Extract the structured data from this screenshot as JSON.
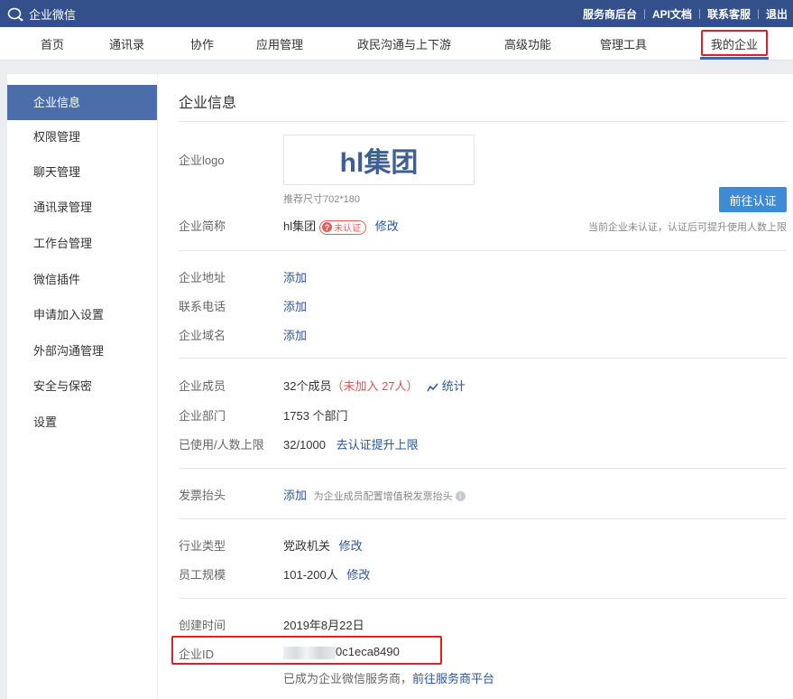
{
  "topbar": {
    "brand": "企业微信",
    "links": [
      "服务商后台",
      "API文档",
      "联系客服",
      "退出"
    ]
  },
  "nav": {
    "items": [
      "首页",
      "通讯录",
      "协作",
      "应用管理",
      "政民沟通与上下游",
      "高级功能",
      "管理工具",
      "我的企业"
    ],
    "active": "我的企业"
  },
  "sidebar": {
    "items": [
      "企业信息",
      "权限管理",
      "聊天管理",
      "通讯录管理",
      "工作台管理",
      "微信插件",
      "申请加入设置",
      "外部沟通管理",
      "安全与保密",
      "设置"
    ],
    "active": "企业信息"
  },
  "main": {
    "title": "企业信息",
    "logo": {
      "label": "企业logo",
      "text": "hl集团",
      "hint": "推荐尺寸702*180"
    },
    "cert": {
      "button": "前往认证",
      "hint": "当前企业未认证，认证后可提升使用人数上限"
    },
    "short_name": {
      "label": "企业简称",
      "value": "hl集团",
      "badge": "未认证",
      "badge_icon": "?",
      "action": "修改"
    },
    "address": {
      "label": "企业地址",
      "action": "添加"
    },
    "phone": {
      "label": "联系电话",
      "action": "添加"
    },
    "domain": {
      "label": "企业域名",
      "action": "添加"
    },
    "members": {
      "label": "企业成员",
      "value": "32个成员",
      "unjoined": "（未加入 27人）",
      "stats": "统计"
    },
    "departments": {
      "label": "企业部门",
      "value": "1753 个部门"
    },
    "limit": {
      "label": "已使用/人数上限",
      "value": "32/1000",
      "action": "去认证提升上限"
    },
    "invoice": {
      "label": "发票抬头",
      "action": "添加",
      "hint": "为企业成员配置增值税发票抬头",
      "info_icon": "i"
    },
    "industry": {
      "label": "行业类型",
      "value": "党政机关",
      "action": "修改"
    },
    "scale": {
      "label": "员工规模",
      "value": "101-200人",
      "action": "修改"
    },
    "created": {
      "label": "创建时间",
      "value": "2019年8月22日"
    },
    "corp_id": {
      "label": "企业ID",
      "value": "0c1eca8490"
    },
    "provider": {
      "text": "已成为企业微信服务商，",
      "link": "前往服务商平台"
    }
  },
  "colors": {
    "topbar": "#33508a",
    "accent": "#2e6bc4",
    "link": "#2b5596",
    "highlight": "#e02020"
  }
}
